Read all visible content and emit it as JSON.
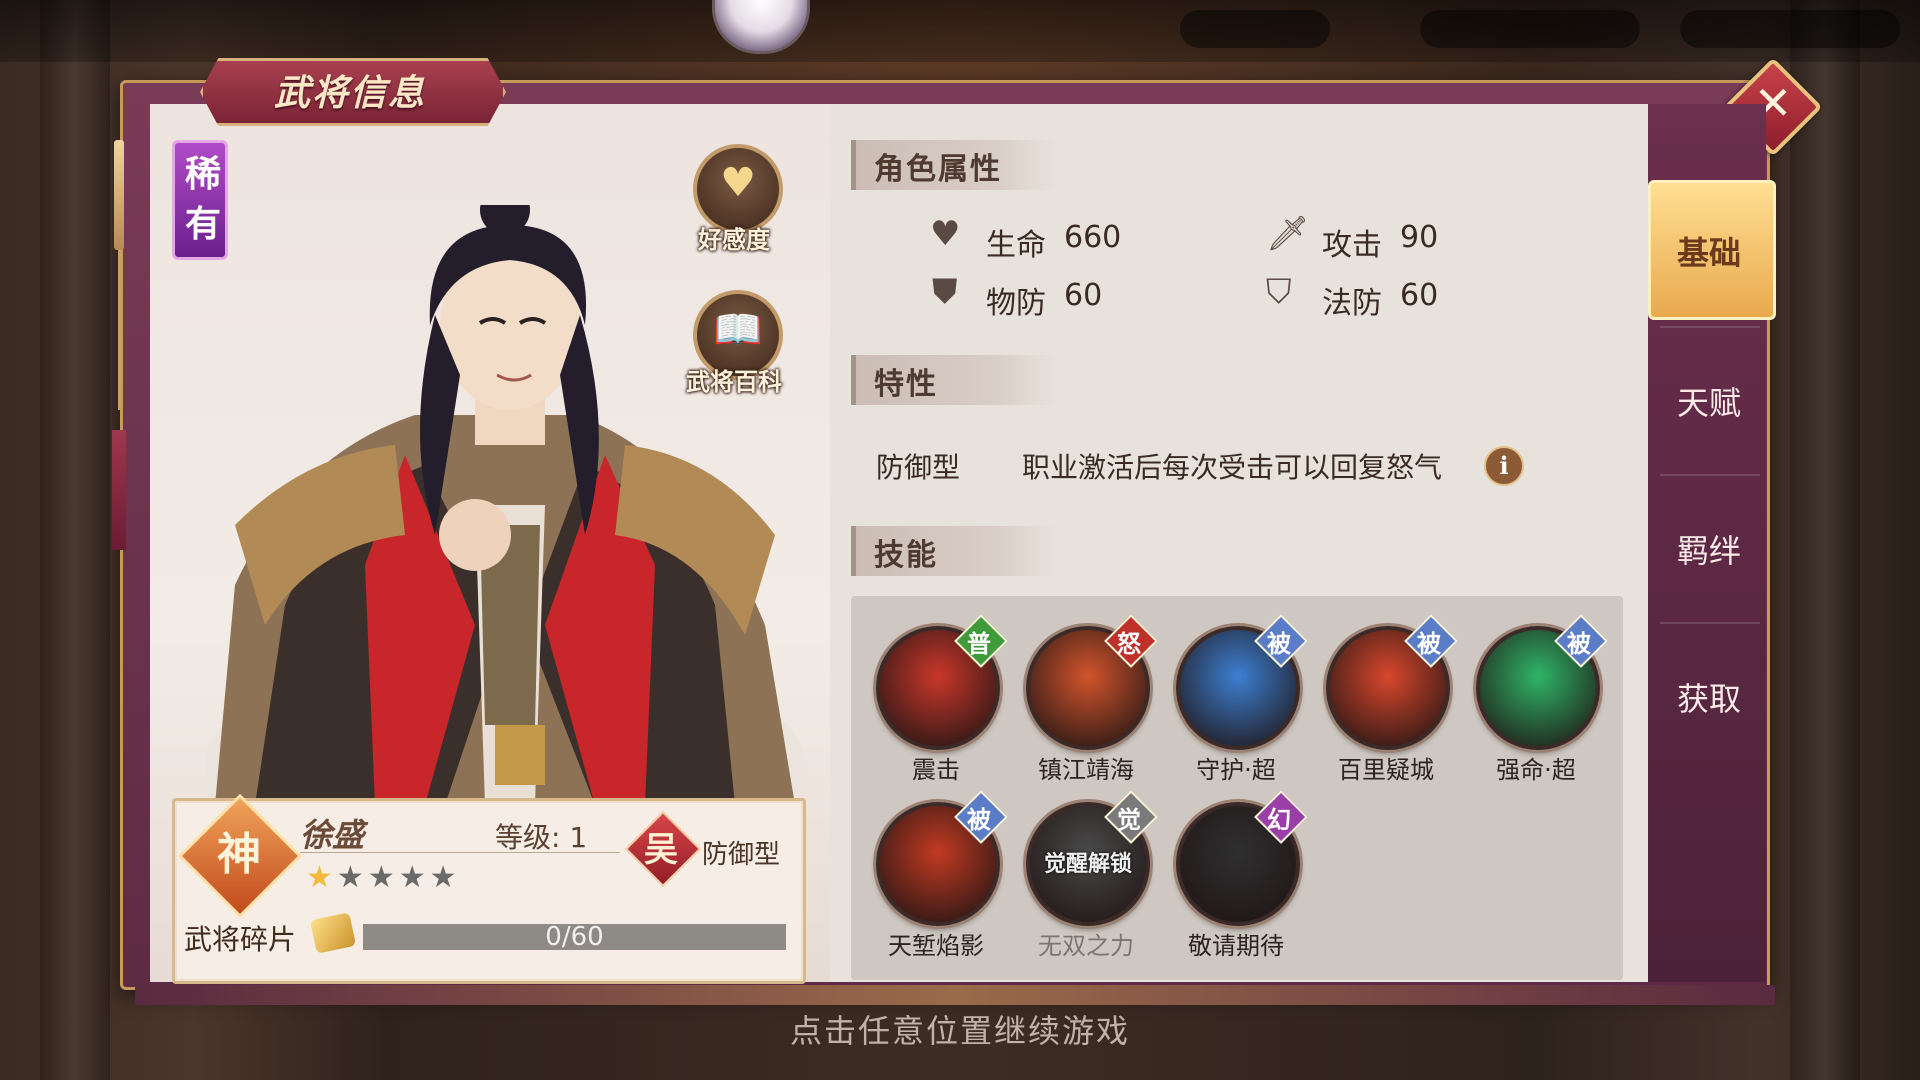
{
  "dialog": {
    "title": "武将信息",
    "close_icon": "close-x-icon"
  },
  "hero": {
    "rarity": "稀有",
    "name": "徐盛",
    "grade_badge": "神",
    "level_label": "等级: 1",
    "faction": "吴",
    "class_type": "防御型",
    "stars_total": 5,
    "stars_filled": 1,
    "fragments_label": "武将碎片",
    "fragments_value": "0/60",
    "fragments_current": 0,
    "fragments_max": 60
  },
  "side_buttons": {
    "affinity_label": "好感度",
    "encyclopedia_label": "武将百科"
  },
  "sections": {
    "attributes_title": "角色属性",
    "trait_title": "特性",
    "skills_title": "技能"
  },
  "attributes": [
    {
      "label": "生命",
      "value": "660",
      "icon": "heart-icon"
    },
    {
      "label": "攻击",
      "value": "90",
      "icon": "sword-icon"
    },
    {
      "label": "物防",
      "value": "60",
      "icon": "shield-icon"
    },
    {
      "label": "法防",
      "value": "60",
      "icon": "magic-shield-icon"
    }
  ],
  "trait": {
    "type": "防御型",
    "description": "职业激活后每次受击可以回复怒气",
    "info_icon": "info-icon"
  },
  "skills": [
    {
      "name": "震击",
      "tag": "普",
      "tag_color": "#3f9a3a",
      "color": "#c9372a",
      "locked": false
    },
    {
      "name": "镇江靖海",
      "tag": "怒",
      "tag_color": "#c0302b",
      "color": "#d2542c",
      "locked": false
    },
    {
      "name": "守护·超",
      "tag": "被",
      "tag_color": "#5b7dc8",
      "color": "#3c7fd2",
      "locked": false
    },
    {
      "name": "百里疑城",
      "tag": "被",
      "tag_color": "#5b7dc8",
      "color": "#d8472c",
      "locked": false
    },
    {
      "name": "强命·超",
      "tag": "被",
      "tag_color": "#5b7dc8",
      "color": "#2fb567",
      "locked": false
    },
    {
      "name": "天堑焰影",
      "tag": "被",
      "tag_color": "#5b7dc8",
      "color": "#c23a22",
      "locked": false
    },
    {
      "name": "无双之力",
      "tag": "觉",
      "tag_color": "#7a7a7a",
      "color": "#4a4a4a",
      "locked": true,
      "lock_text": "觉醒解锁"
    },
    {
      "name": "敬请期待",
      "tag": "幻",
      "tag_color": "#9a3fa8",
      "color": "#2f2f30",
      "locked": false
    }
  ],
  "tabs": [
    {
      "label": "基础",
      "active": true
    },
    {
      "label": "天赋",
      "active": false
    },
    {
      "label": "羁绊",
      "active": false
    },
    {
      "label": "获取",
      "active": false
    }
  ],
  "footer": {
    "continue_hint": "点击任意位置继续游戏"
  }
}
